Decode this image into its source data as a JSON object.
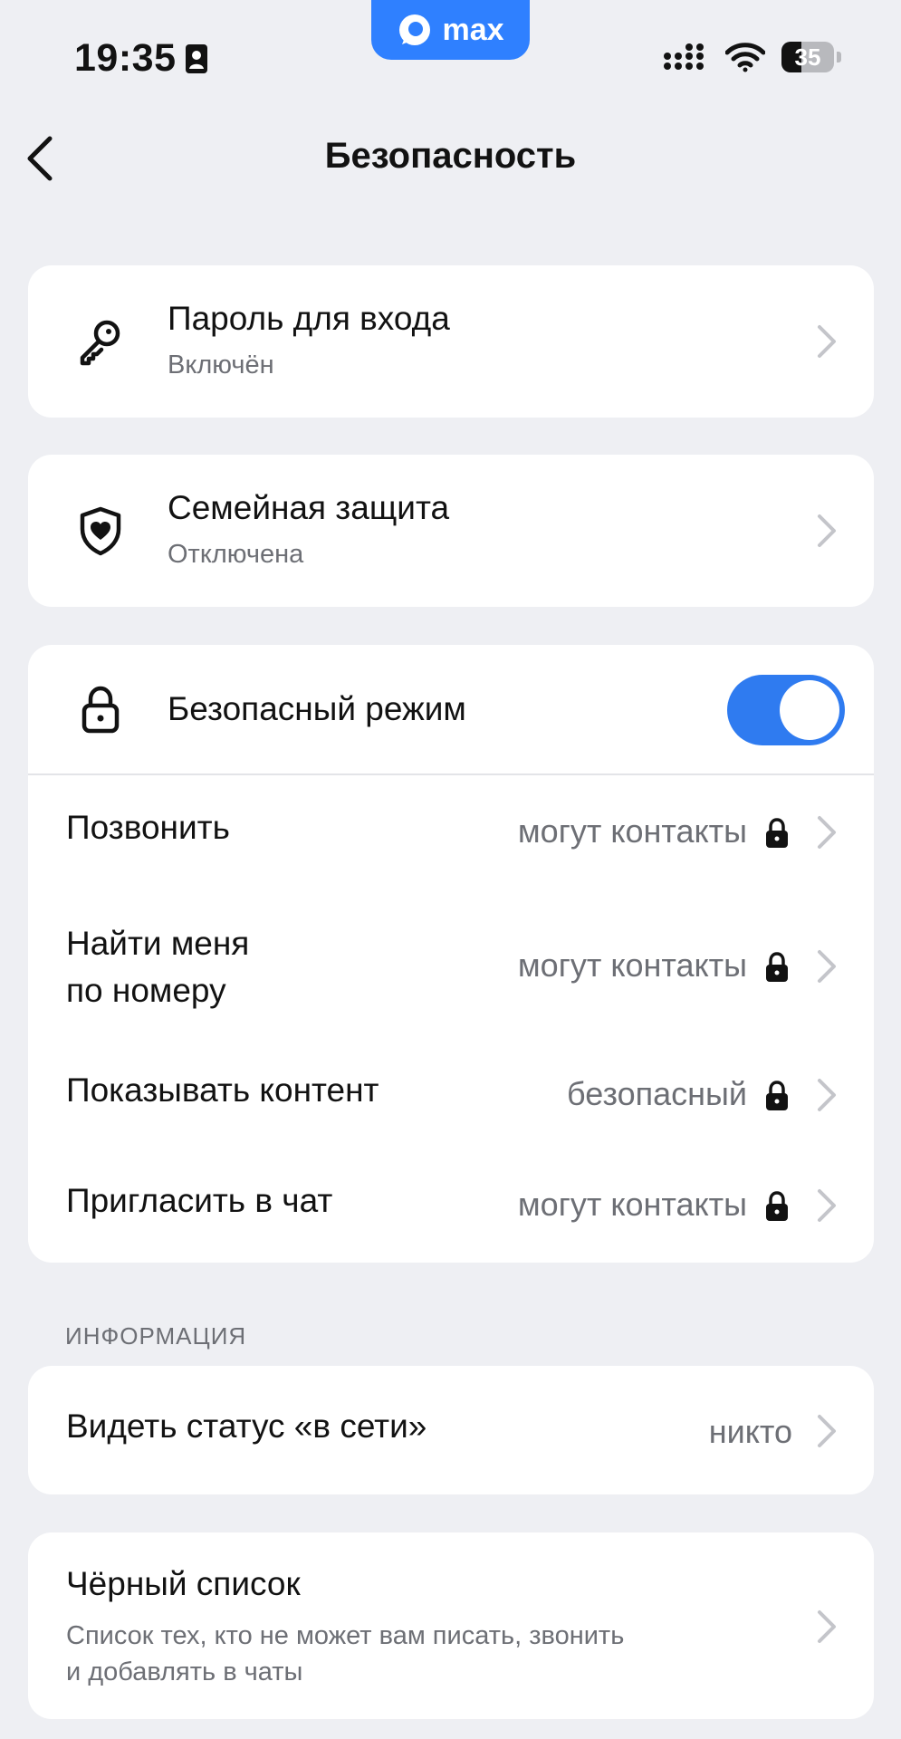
{
  "status_bar": {
    "time": "19:35",
    "app_pill": "max",
    "battery": "35"
  },
  "header": {
    "title": "Безопасность"
  },
  "cards": {
    "password": {
      "title": "Пароль для входа",
      "subtitle": "Включён"
    },
    "family": {
      "title": "Семейная защита",
      "subtitle": "Отключена"
    },
    "safe_mode": {
      "title": "Безопасный режим",
      "enabled": true,
      "rows": [
        {
          "label": "Позвонить",
          "value": "могут контакты"
        },
        {
          "label_line1": "Найти меня",
          "label_line2": "по номеру",
          "value": "могут контакты"
        },
        {
          "label": "Показывать контент",
          "value": "безопасный"
        },
        {
          "label": "Пригласить в чат",
          "value": "могут контакты"
        }
      ]
    }
  },
  "info_section": {
    "header": "ИНФОРМАЦИЯ",
    "online_status": {
      "label": "Видеть статус «в сети»",
      "value": "никто"
    }
  },
  "blacklist": {
    "title": "Чёрный список",
    "subtitle_line1": "Список тех, кто не может вам писать, звонить",
    "subtitle_line2": "и добавлять в чаты"
  },
  "colors": {
    "background": "#eeeff3",
    "card": "#ffffff",
    "accent": "#2f7bf0",
    "secondary_text": "#6d6f75"
  }
}
